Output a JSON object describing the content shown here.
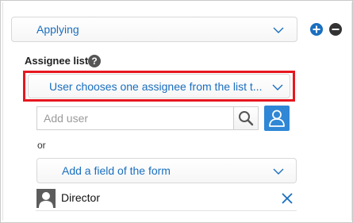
{
  "status_dropdown": {
    "selected": "Applying"
  },
  "assignee_section": {
    "label": "Assignee list",
    "help_glyph": "?",
    "mode_dropdown": {
      "selected": "User chooses one assignee from the list t..."
    },
    "search": {
      "placeholder": "Add user",
      "value": ""
    },
    "or_text": "or",
    "field_dropdown": {
      "selected": "Add a field of the form"
    },
    "assignees": [
      {
        "name": "Director"
      }
    ]
  },
  "colors": {
    "accent": "#1a6fbf",
    "highlight_border": "#e8171f",
    "add_button": "#1a6fbf",
    "remove_button": "#333333",
    "user_pick_button": "#2f87d6"
  },
  "icons": [
    "plus-circle-icon",
    "minus-circle-icon",
    "chevron-down-icon",
    "help-icon",
    "search-icon",
    "user-icon",
    "avatar-icon",
    "close-icon"
  ]
}
